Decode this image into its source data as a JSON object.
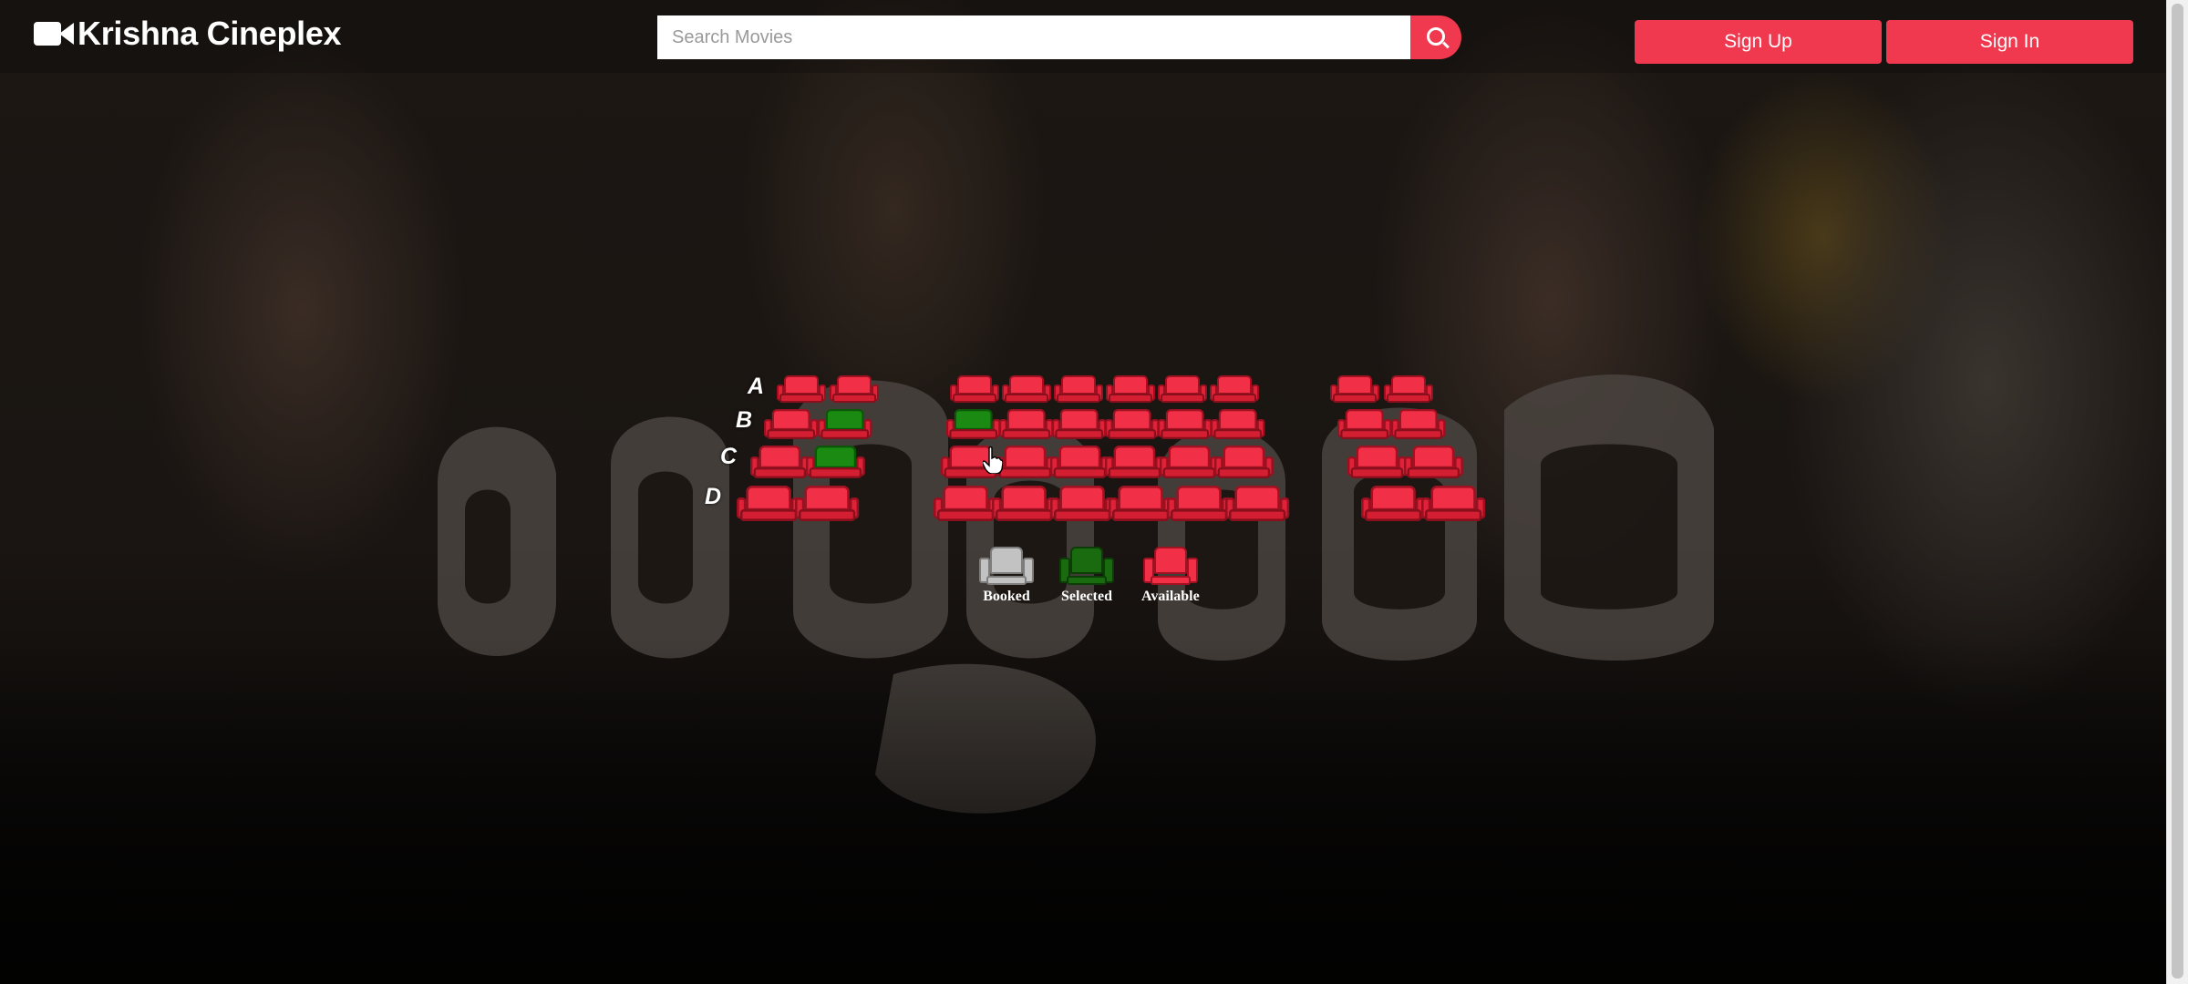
{
  "brand": {
    "name": "Krishna Cineplex",
    "icon": "video-camera-icon"
  },
  "search": {
    "placeholder": "Search Movies",
    "value": "",
    "icon": "search-icon"
  },
  "auth": {
    "signup_label": "Sign Up",
    "signin_label": "Sign In"
  },
  "colors": {
    "accent": "#f0394f",
    "available": "#f13048",
    "selected": "#1a8a12",
    "booked": "#b8b8b8"
  },
  "seating": {
    "rows": [
      {
        "label": "A",
        "seats": [
          "available",
          "available",
          "available",
          "available",
          "available",
          "available",
          "available",
          "available",
          "available",
          "available"
        ]
      },
      {
        "label": "B",
        "seats": [
          "available",
          "selected",
          "selected",
          "available",
          "available",
          "available",
          "available",
          "available",
          "available",
          "available"
        ]
      },
      {
        "label": "C",
        "seats": [
          "available",
          "selected",
          "available",
          "available",
          "available",
          "available",
          "available",
          "available",
          "available",
          "available"
        ]
      },
      {
        "label": "D",
        "seats": [
          "available",
          "available",
          "available",
          "available",
          "available",
          "available",
          "available",
          "available",
          "available",
          "available"
        ]
      }
    ]
  },
  "legend": [
    {
      "label": "Booked",
      "status": "booked"
    },
    {
      "label": "Selected",
      "status": "selected"
    },
    {
      "label": "Available",
      "status": "available"
    }
  ]
}
